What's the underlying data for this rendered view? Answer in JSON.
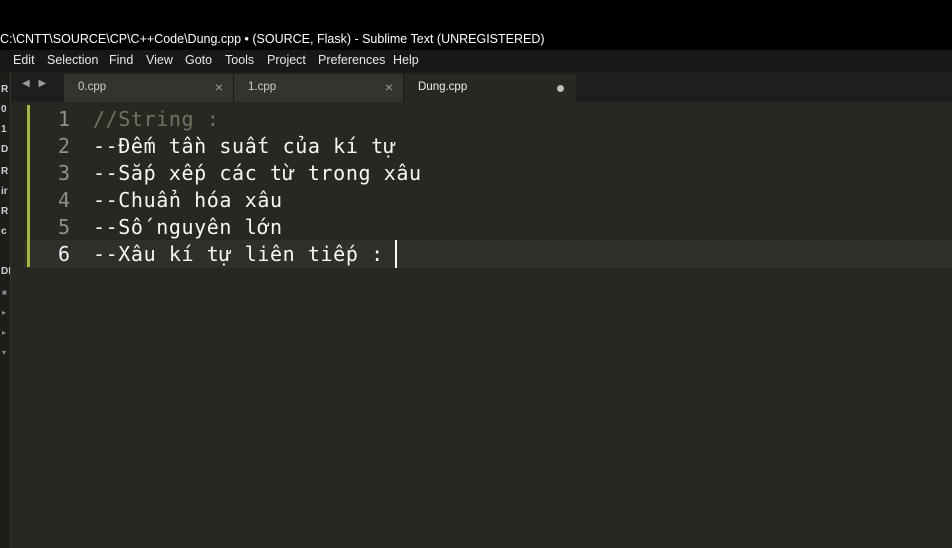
{
  "window": {
    "title": "C:\\CNTT\\SOURCE\\CP\\C++Code\\Dung.cpp • (SOURCE, Flask) - Sublime Text (UNREGISTERED)"
  },
  "menu": [
    "Edit",
    "Selection",
    "Find",
    "View",
    "Goto",
    "Tools",
    "Project",
    "Preferences",
    "Help"
  ],
  "tabs": [
    {
      "label": "0.cpp",
      "active": false,
      "close": "×"
    },
    {
      "label": "1.cpp",
      "active": false,
      "close": "×"
    },
    {
      "label": "Dung.cpp",
      "active": true,
      "modified": true
    }
  ],
  "nav_arrows": "◀ ▶",
  "sidebar_glyphs": [
    "R",
    "0",
    "1",
    "D",
    "R",
    "ir",
    "R",
    "c",
    "DI"
  ],
  "editor": {
    "current_line": 6,
    "lines": [
      {
        "number": "1",
        "text": "//String :",
        "style": "comment"
      },
      {
        "number": "2",
        "text": "--Đếm tần suất của kí tự",
        "style": "text"
      },
      {
        "number": "3",
        "text": "--Sắp xếp các từ trong xâu",
        "style": "text"
      },
      {
        "number": "4",
        "text": "--Chuẩn hóa xâu",
        "style": "text"
      },
      {
        "number": "5",
        "text": "--Số nguyên lớn",
        "style": "text"
      },
      {
        "number": "6",
        "text": "--Xâu kí tự liên tiếp :",
        "style": "text"
      }
    ]
  },
  "colors": {
    "background": "#272822",
    "comment": "#75715e",
    "text": "#f8f8f2",
    "gutter_modified": "#a6b93c"
  }
}
